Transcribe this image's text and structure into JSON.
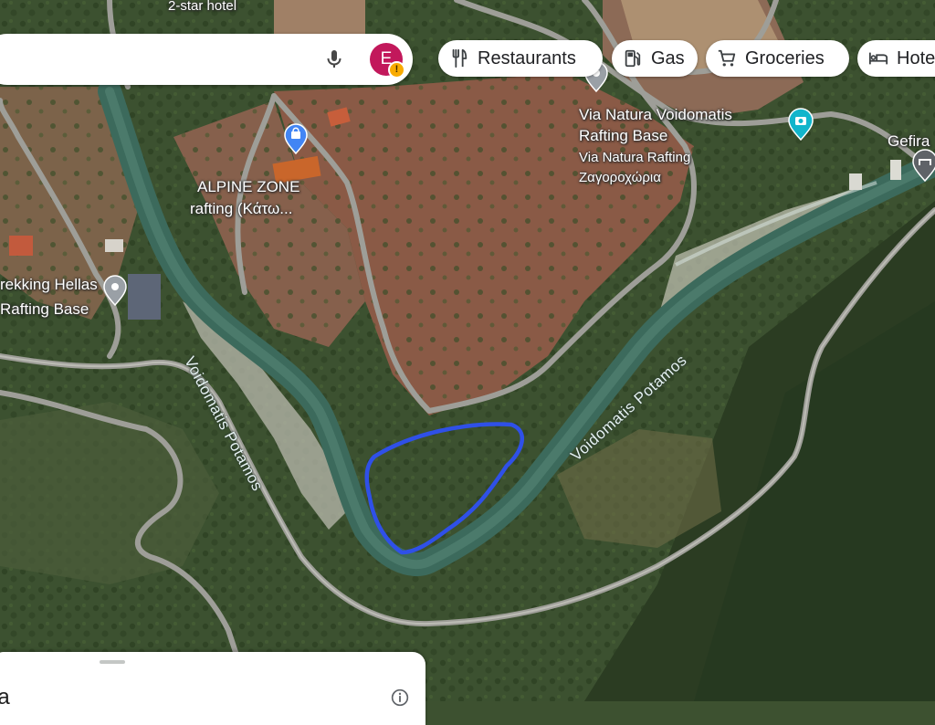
{
  "search": {
    "placeholder": "",
    "avatar_letter": "E",
    "avatar_warning": "!",
    "avatar_color": "#c2185b"
  },
  "chips": [
    {
      "label": "Restaurants",
      "icon": "restaurant-icon"
    },
    {
      "label": "Gas",
      "icon": "gas-station-icon"
    },
    {
      "label": "Groceries",
      "icon": "grocery-cart-icon"
    },
    {
      "label": "Hotels",
      "icon": "hotel-bed-icon"
    }
  ],
  "map": {
    "labels": {
      "two_star_hotel": "2-star hotel",
      "alpine_zone": "ALPINE ZONE",
      "alpine_zone_sub": "rafting (Κάτω...",
      "trekking": "rekking Hellas",
      "trekking_sub": "Rafting Base",
      "via_natura": "Via Natura Voidomatis",
      "via_natura_sub": "Rafting Base",
      "via_natura_desc": "Via Natura Rafting",
      "via_natura_desc2": "Ζαγοροχώρια",
      "gefira": "Gefira"
    },
    "rivers": [
      "Voidomatis Potamos",
      "Voidomatis Potamos"
    ],
    "highlight_color": "#2f50e8",
    "pin_color": "#4285f4",
    "attraction_color": "#12b5cb"
  },
  "bottom_sheet": {
    "title": "ea"
  }
}
